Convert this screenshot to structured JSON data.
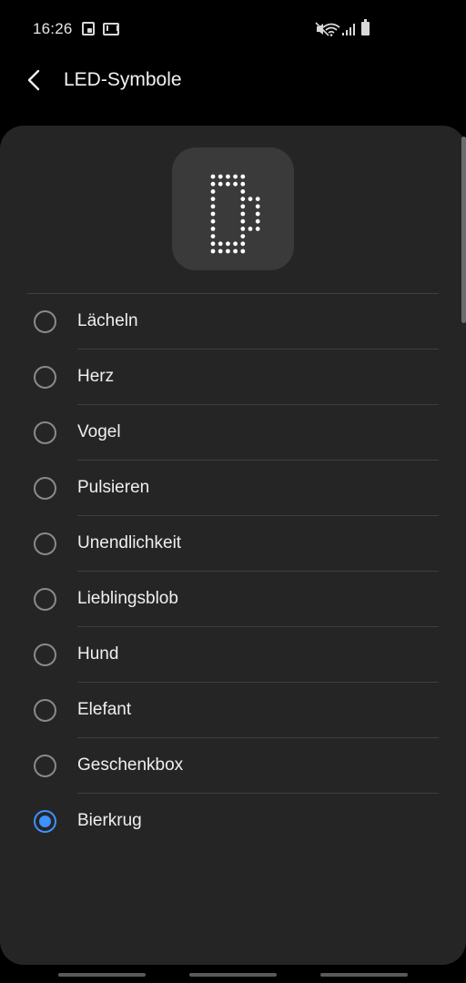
{
  "status_bar": {
    "time": "16:26",
    "icons": [
      "notification-icon",
      "mail-icon",
      "mute-icon",
      "wifi-icon",
      "signal-icon",
      "battery-icon"
    ]
  },
  "header": {
    "title": "LED-Symbole",
    "back_icon": "chevron-left-icon"
  },
  "preview": {
    "icon": "beer-mug-led-icon"
  },
  "options": [
    {
      "label": "Lächeln",
      "selected": false
    },
    {
      "label": "Herz",
      "selected": false
    },
    {
      "label": "Vogel",
      "selected": false
    },
    {
      "label": "Pulsieren",
      "selected": false
    },
    {
      "label": "Unendlichkeit",
      "selected": false
    },
    {
      "label": "Lieblingsblob",
      "selected": false
    },
    {
      "label": "Hund",
      "selected": false
    },
    {
      "label": "Elefant",
      "selected": false
    },
    {
      "label": "Geschenkbox",
      "selected": false
    },
    {
      "label": "Bierkrug",
      "selected": true
    }
  ],
  "colors": {
    "accent": "#3e91ff",
    "card": "#252525",
    "background": "#000000"
  }
}
